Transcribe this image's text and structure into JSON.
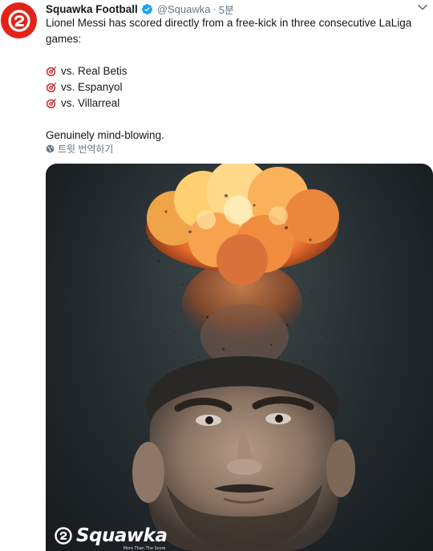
{
  "tweet": {
    "author": {
      "display_name": "Squawka Football",
      "handle": "@Squawka",
      "separator": "·",
      "time": "5분",
      "verified_icon": "verified-badge-icon",
      "avatar_icon": "squawka-logo-icon"
    },
    "text": {
      "intro": "Lionel Messi has scored directly from a free-kick in three consecutive LaLiga games:",
      "matches": [
        {
          "emoji": "dart-target-icon",
          "label": "vs. Real Betis"
        },
        {
          "emoji": "dart-target-icon",
          "label": "vs. Espanyol"
        },
        {
          "emoji": "dart-target-icon",
          "label": "vs. Villarreal"
        }
      ],
      "closing": "Genuinely mind-blowing."
    },
    "translate_label": "트윗 번역하기",
    "media": {
      "watermark_brand": "Squawka",
      "watermark_tagline": "More Than The Score"
    }
  },
  "colors": {
    "brand_red": "#e2231a",
    "verified_blue": "#1da1f2",
    "text_primary": "#14171a",
    "text_secondary": "#657786"
  }
}
